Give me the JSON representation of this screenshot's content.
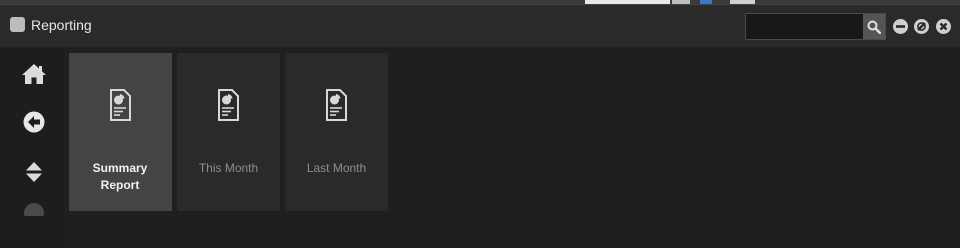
{
  "window": {
    "title": "Reporting"
  },
  "search": {
    "value": "",
    "placeholder": ""
  },
  "sidebar": {
    "items": [
      {
        "name": "home",
        "icon": "home-icon"
      },
      {
        "name": "back",
        "icon": "back-arrow-icon"
      },
      {
        "name": "expand-collapse",
        "icon": "sort-updown-icon"
      },
      {
        "name": "more",
        "icon": "more-icon"
      }
    ]
  },
  "tiles": [
    {
      "label": "Summary Report",
      "icon": "report-document-icon",
      "selected": true
    },
    {
      "label": "This Month",
      "icon": "report-document-icon",
      "selected": false
    },
    {
      "label": "Last Month",
      "icon": "report-document-icon",
      "selected": false
    }
  ],
  "colors": {
    "window_bg": "#232323",
    "titlebar_bg": "#2a2a2a",
    "tile_bg": "#2a2a2a",
    "tile_active_bg": "#444444",
    "text_active": "#f2f2f2",
    "text_muted": "#8e8e8e",
    "icon": "#d8d8d8"
  }
}
